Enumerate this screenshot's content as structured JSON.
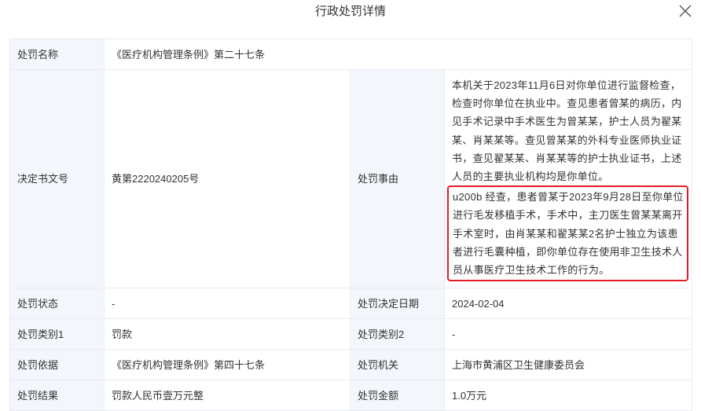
{
  "modal": {
    "title": "行政处罚详情",
    "close_icon": "close-icon"
  },
  "rows": {
    "penalty_name": {
      "label": "处罚名称",
      "value": "《医疗机构管理条例》第二十七条"
    },
    "decision_no": {
      "label": "决定书文号",
      "value": "黄第2220240205号"
    },
    "penalty_reason": {
      "label": "处罚事由",
      "para1": "本机关于2023年11月6日对你单位进行监督检查，检查时你单位在执业中。查见患者曾某的病历，内见手术记录中手术医生为曾某某，护士人员为翟某某、肖某某等。查见曾某某的外科专业医师执业证书，查见翟某某、肖某某等的护士执业证书，上述人员的主要执业机构均是你单位。",
      "para2": "u200b 经查，患者曾某于2023年9月28日至你单位进行毛发移植手术，手术中，主刀医生曾某某离开手术室时，由肖某某和翟某某2名护士独立为该患者进行毛囊种植，即你单位存在使用非卫生技术人员从事医疗卫生技术工作的行为。"
    },
    "penalty_status": {
      "label": "处罚状态",
      "value": "-"
    },
    "decision_date": {
      "label": "处罚决定日期",
      "value": "2024-02-04"
    },
    "category1": {
      "label": "处罚类别1",
      "value": "罚款"
    },
    "category2": {
      "label": "处罚类别2",
      "value": "-"
    },
    "basis": {
      "label": "处罚依据",
      "value": "《医疗机构管理条例》第四十七条"
    },
    "authority": {
      "label": "处罚机关",
      "value": "上海市黄浦区卫生健康委员会"
    },
    "result": {
      "label": "处罚结果",
      "value": "罚款人民币壹万元整"
    },
    "amount": {
      "label": "处罚金额",
      "value": "1.0万元"
    }
  },
  "colors": {
    "label_bg": "#f3f6fb",
    "border": "#e8ebf0",
    "highlight": "#e01b24"
  }
}
